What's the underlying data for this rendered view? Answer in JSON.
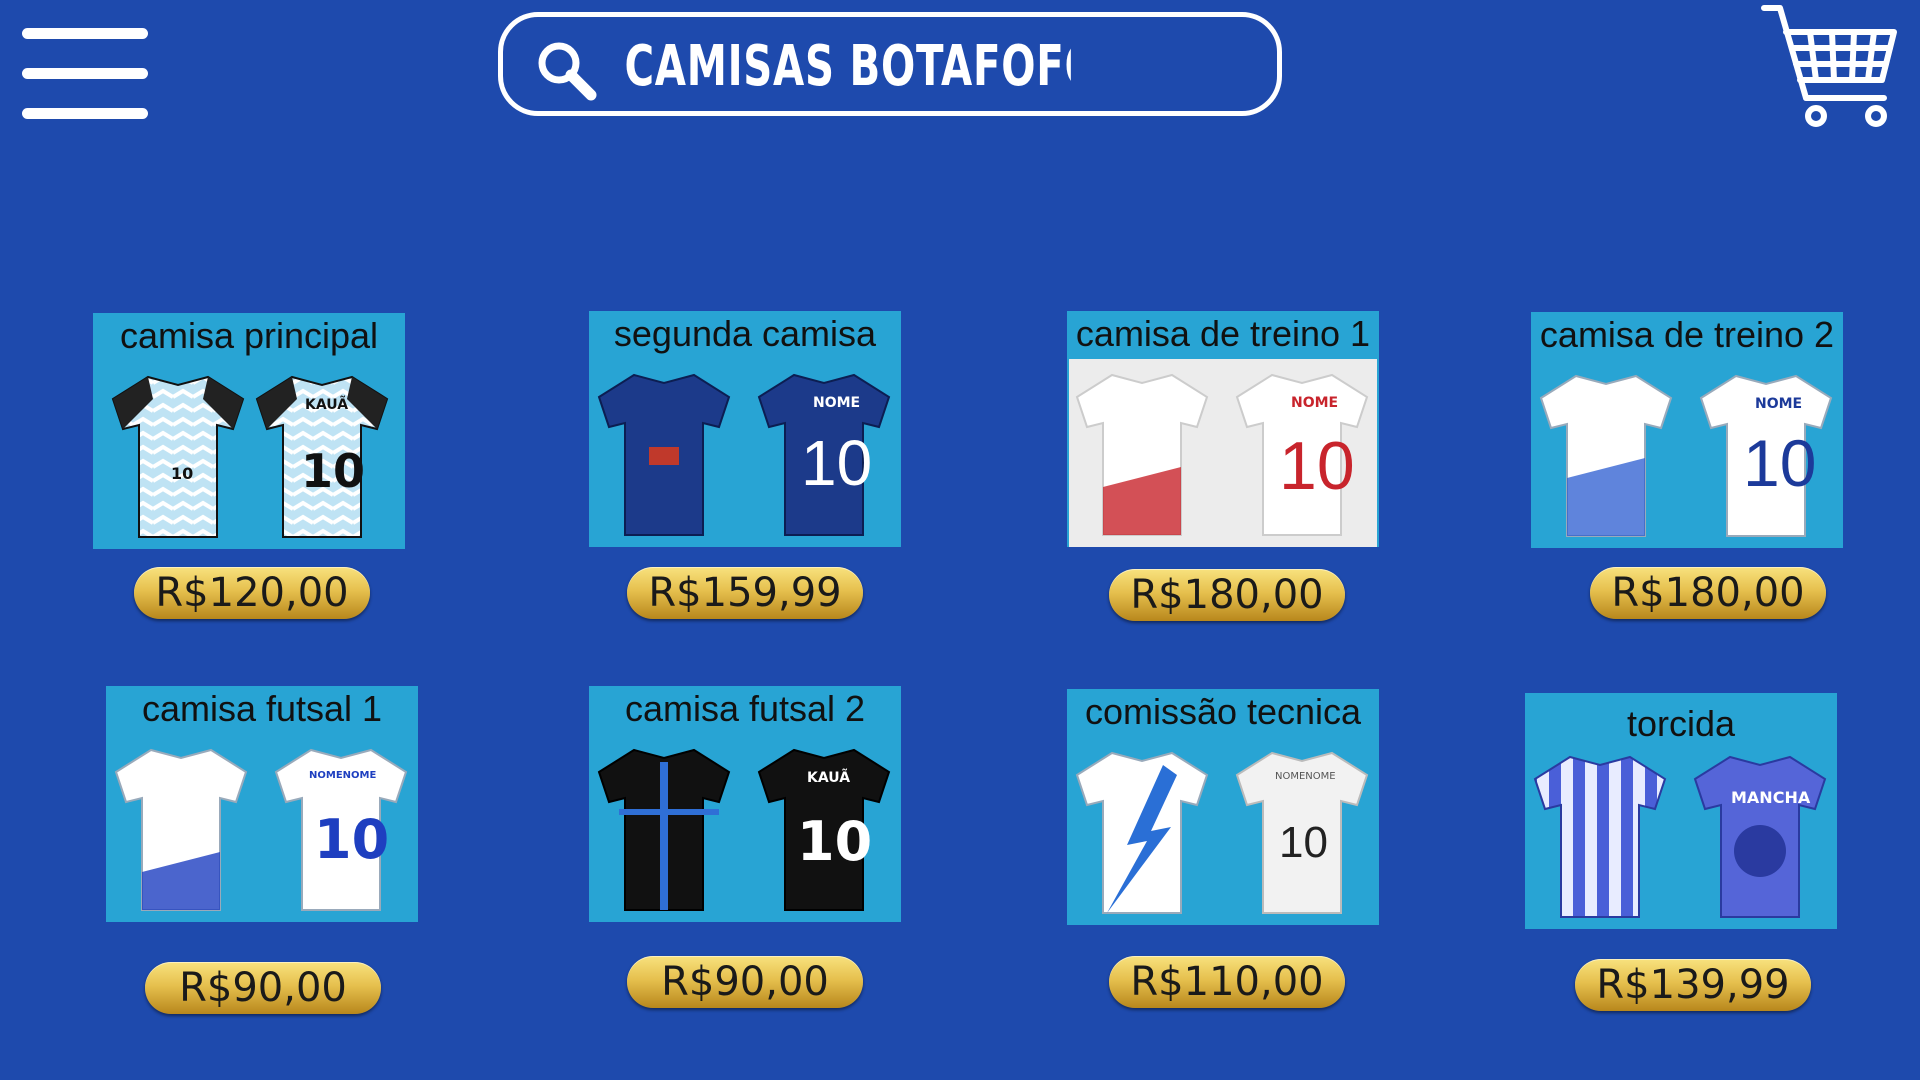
{
  "header": {
    "menu_icon": "hamburger-menu-icon",
    "search_icon": "search-icon",
    "search_value": "CAMISAS BOTAFOFO",
    "cart_icon": "shopping-cart-icon"
  },
  "colors": {
    "background": "#1e4aad",
    "card": "#28a4d4",
    "price_badge": "#e6c04e",
    "white": "#ffffff"
  },
  "products": [
    {
      "title": "camisa principal",
      "price": "R$120,00",
      "jersey_number": "10",
      "jersey_name": "KAUÃ"
    },
    {
      "title": "segunda camisa",
      "price": "R$159,99",
      "jersey_number": "10",
      "jersey_name": "NOME"
    },
    {
      "title": "camisa de treino 1",
      "price": "R$180,00",
      "jersey_number": "10",
      "jersey_name": "NOME"
    },
    {
      "title": "camisa de treino 2",
      "price": "R$180,00",
      "jersey_number": "10",
      "jersey_name": "NOME"
    },
    {
      "title": "camisa futsal 1",
      "price": "R$90,00",
      "jersey_number": "10",
      "jersey_name": "NOMENOME"
    },
    {
      "title": "camisa futsal 2",
      "price": "R$90,00",
      "jersey_number": "10",
      "jersey_name": "KAUÃ"
    },
    {
      "title": "comissão tecnica",
      "price": "R$110,00",
      "jersey_number": "10",
      "jersey_name": "NOMENOME"
    },
    {
      "title": "torcida",
      "price": "R$139,99",
      "jersey_name": "MANCHA"
    }
  ]
}
